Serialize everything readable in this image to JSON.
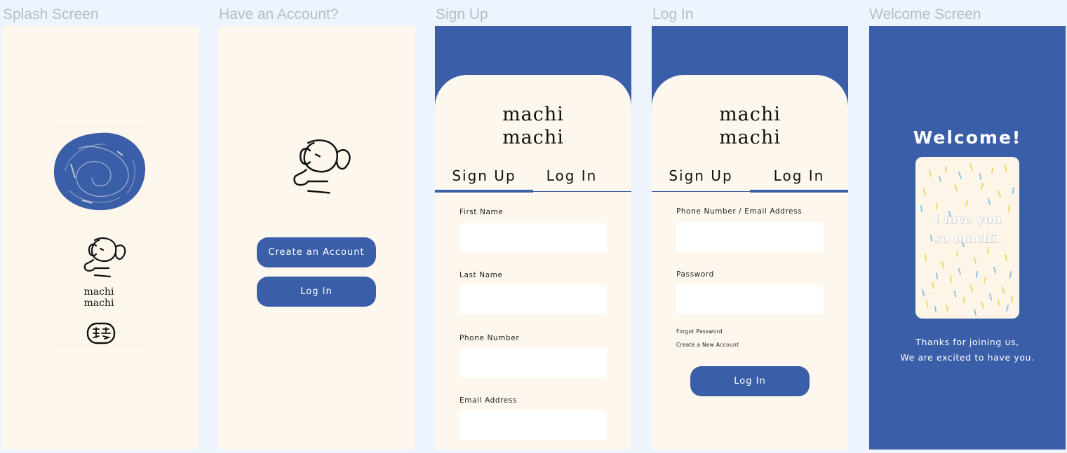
{
  "frames": {
    "splash": {
      "title": "Splash Screen",
      "brand_line1": "machi",
      "brand_line2": "machi"
    },
    "account": {
      "title": "Have an Account?",
      "create_label": "Create an Account",
      "login_label": "Log In"
    },
    "signup": {
      "title": "Sign Up",
      "brand_line1": "machi",
      "brand_line2": "machi",
      "tab_signup": "Sign Up",
      "tab_login": "Log In",
      "fields": [
        "First Name",
        "Last Name",
        "Phone Number",
        "Email Address"
      ]
    },
    "login": {
      "title": "Log In",
      "brand_line1": "machi",
      "brand_line2": "machi",
      "tab_signup": "Sign Up",
      "tab_login": "Log In",
      "field_user": "Phone Number / Email Address",
      "field_pass": "Password",
      "forgot": "Forgot Password",
      "create": "Create a New Account",
      "button": "Log In"
    },
    "welcome": {
      "title": "Welcome Screen",
      "heading": "Welcome!",
      "card_line1": "I love you",
      "card_line2": "so machi.",
      "thanks_line1": "Thanks for joining us,",
      "thanks_line2": "We are excited to have you."
    }
  },
  "colors": {
    "accent": "#3a5fa8",
    "cream": "#fef7ee",
    "canvas": "#eef4fd"
  }
}
